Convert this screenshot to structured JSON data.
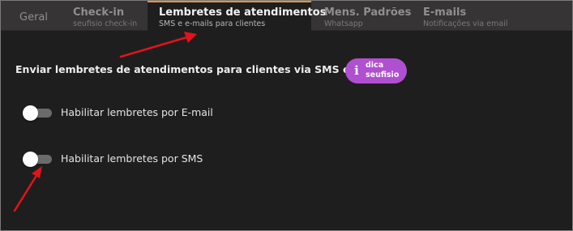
{
  "tabs": [
    {
      "title": "Geral",
      "subtitle": ""
    },
    {
      "title": "Check-in",
      "subtitle": "seufisio check-in"
    },
    {
      "title": "Lembretes de atendimentos",
      "subtitle": "SMS e e-mails para clientes"
    },
    {
      "title": "Mens. Padrões",
      "subtitle": "Whatsapp"
    },
    {
      "title": "E-mails",
      "subtitle": "Notificações via email"
    }
  ],
  "active_tab": "Lembretes de atendimentos",
  "section": {
    "heading": "Enviar lembretes de atendimentos para clientes via SMS e E-mail",
    "tip": {
      "icon": "info-icon",
      "icon_glyph": "i",
      "line1": "dica",
      "line2": "seufisio"
    }
  },
  "toggles": [
    {
      "label": "Habilitar lembretes por E-mail",
      "enabled": false
    },
    {
      "label": "Habilitar lembretes por SMS",
      "enabled": false
    }
  ],
  "annotations": {
    "arrow_color": "#e0141b"
  },
  "colors": {
    "accent": "#e8913a",
    "tip": "#b04fd0",
    "background": "#1f1e1e",
    "tabbar": "#363434"
  }
}
